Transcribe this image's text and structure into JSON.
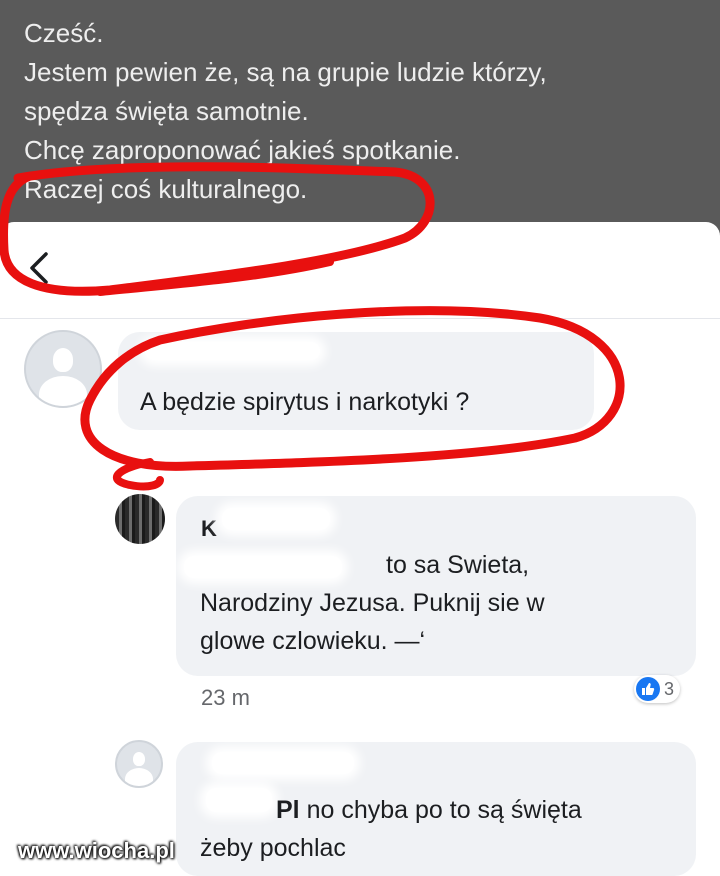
{
  "post": {
    "lines": [
      "Cześć.",
      "Jestem pewien że, są na grupie ludzie którzy,",
      "spędza święta samotnie.",
      "Chcę zaproponować jakieś spotkanie.",
      "Raczej coś kulturalnego."
    ]
  },
  "header": {
    "back_icon": "‹"
  },
  "comments": [
    {
      "author": "",
      "text_lines": [
        "A będzie spirytus i narkotyki ?"
      ],
      "time": ""
    },
    {
      "author": "K",
      "mention": "",
      "text_lines": [
        "to sa Swieta,",
        "Narodziny Jezusa. Puknij sie w",
        "glowe czlowieku. —‘"
      ],
      "time": "23 m",
      "reaction_count": "3"
    },
    {
      "author": "",
      "mention": "Pl",
      "text_lines": [
        "no chyba po to są święta",
        "żeby pochlac"
      ],
      "time": ""
    }
  ],
  "watermark": "www.wiocha.pl",
  "colors": {
    "annotation": "#e8100f",
    "like_blue": "#1877f2",
    "bubble": "#f0f2f5"
  }
}
